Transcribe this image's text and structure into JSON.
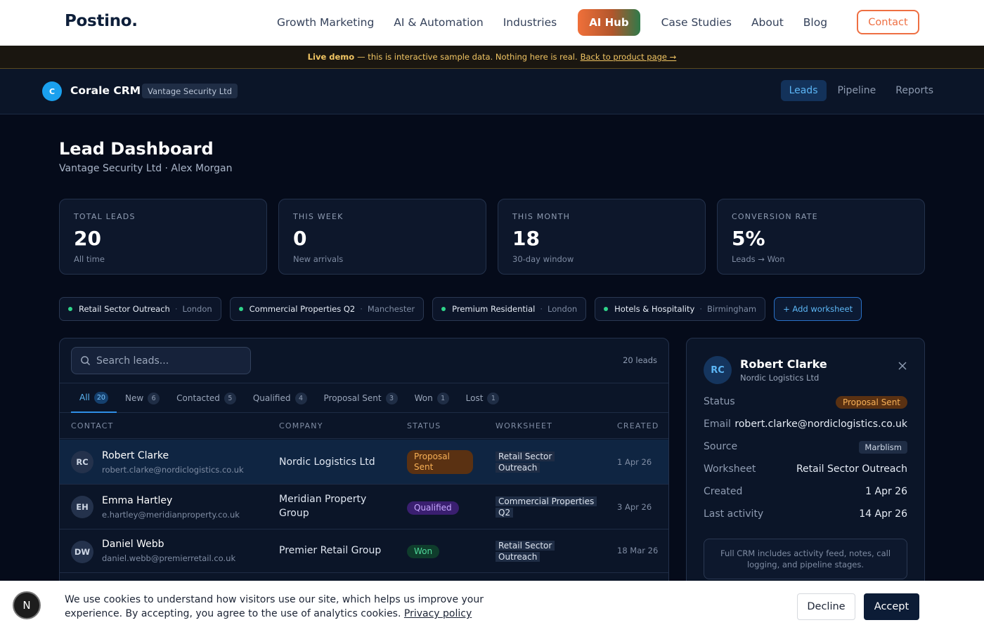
{
  "site": {
    "logo": "Postino.",
    "nav": [
      "Growth Marketing",
      "AI & Automation",
      "Industries",
      "AI Hub",
      "Case Studies",
      "About",
      "Blog"
    ],
    "contact_label": "Contact"
  },
  "banner": {
    "strong": "Live demo",
    "text": "— this is interactive sample data. Nothing here is real.",
    "link": "Back to product page →"
  },
  "crm": {
    "logo_letter": "C",
    "name": "Corale CRM",
    "org": "Vantage Security Ltd",
    "tabs": [
      "Leads",
      "Pipeline",
      "Reports"
    ]
  },
  "page": {
    "title": "Lead Dashboard",
    "subtitle": "Vantage Security Ltd · Alex Morgan"
  },
  "stats": [
    {
      "label": "TOTAL LEADS",
      "value": "20",
      "note": "All time"
    },
    {
      "label": "THIS WEEK",
      "value": "0",
      "note": "New arrivals"
    },
    {
      "label": "THIS MONTH",
      "value": "18",
      "note": "30-day window"
    },
    {
      "label": "CONVERSION RATE",
      "value": "5%",
      "note": "Leads → Won"
    }
  ],
  "worksheets": [
    {
      "name": "Retail Sector Outreach",
      "location": "London"
    },
    {
      "name": "Commercial Properties Q2",
      "location": "Manchester"
    },
    {
      "name": "Premium Residential",
      "location": "London"
    },
    {
      "name": "Hotels & Hospitality",
      "location": "Birmingham"
    }
  ],
  "add_worksheet": "+ Add worksheet",
  "table": {
    "search_placeholder": "Search leads...",
    "lead_count": "20 leads",
    "filters": [
      {
        "label": "All",
        "count": "20"
      },
      {
        "label": "New",
        "count": "6"
      },
      {
        "label": "Contacted",
        "count": "5"
      },
      {
        "label": "Qualified",
        "count": "4"
      },
      {
        "label": "Proposal Sent",
        "count": "3"
      },
      {
        "label": "Won",
        "count": "1"
      },
      {
        "label": "Lost",
        "count": "1"
      }
    ],
    "columns": [
      "CONTACT",
      "COMPANY",
      "STATUS",
      "WORKSHEET",
      "CREATED"
    ],
    "rows": [
      {
        "initials": "RC",
        "name": "Robert Clarke",
        "email": "robert.clarke@nordiclogistics.co.uk",
        "company_l1": "Nordic Logistics Ltd",
        "company_l2": "",
        "status_l1": "Proposal",
        "status_l2": "Sent",
        "ws_l1": "Retail Sector",
        "ws_l2": "Outreach",
        "created": "1 Apr 26"
      },
      {
        "initials": "EH",
        "name": "Emma Hartley",
        "email": "e.hartley@meridianproperty.co.uk",
        "company_l1": "Meridian Property",
        "company_l2": "Group",
        "status_l1": "Qualified",
        "status_l2": "",
        "ws_l1": "Commercial Properties",
        "ws_l2": "Q2",
        "created": "3 Apr 26"
      },
      {
        "initials": "DW",
        "name": "Daniel Webb",
        "email": "daniel.webb@premierretail.co.uk",
        "company_l1": "Premier Retail Group",
        "company_l2": "",
        "status_l1": "Won",
        "status_l2": "",
        "ws_l1": "Retail Sector",
        "ws_l2": "Outreach",
        "created": "18 Mar 26"
      }
    ]
  },
  "detail": {
    "initials": "RC",
    "name": "Robert Clarke",
    "company": "Nordic Logistics Ltd",
    "fields": {
      "status_k": "Status",
      "status_v": "Proposal Sent",
      "email_k": "Email",
      "email_v": "robert.clarke@nordiclogistics.co.uk",
      "source_k": "Source",
      "source_v": "Marblism",
      "worksheet_k": "Worksheet",
      "worksheet_v": "Retail Sector Outreach",
      "created_k": "Created",
      "created_v": "1 Apr 26",
      "activity_k": "Last activity",
      "activity_v": "14 Apr 26"
    },
    "note": "Full CRM includes activity feed, notes, call logging, and pipeline stages."
  },
  "cookie": {
    "badge": "N",
    "text": "We use cookies to understand how visitors use our site, which helps us improve your experience. By accepting, you agree to the use of analytics cookies.",
    "policy": "Privacy policy",
    "decline": "Decline",
    "accept": "Accept"
  },
  "colors": {
    "accent": "#2f8fe6",
    "brand_orange": "#ee6f42",
    "bg": "#050b1a"
  }
}
